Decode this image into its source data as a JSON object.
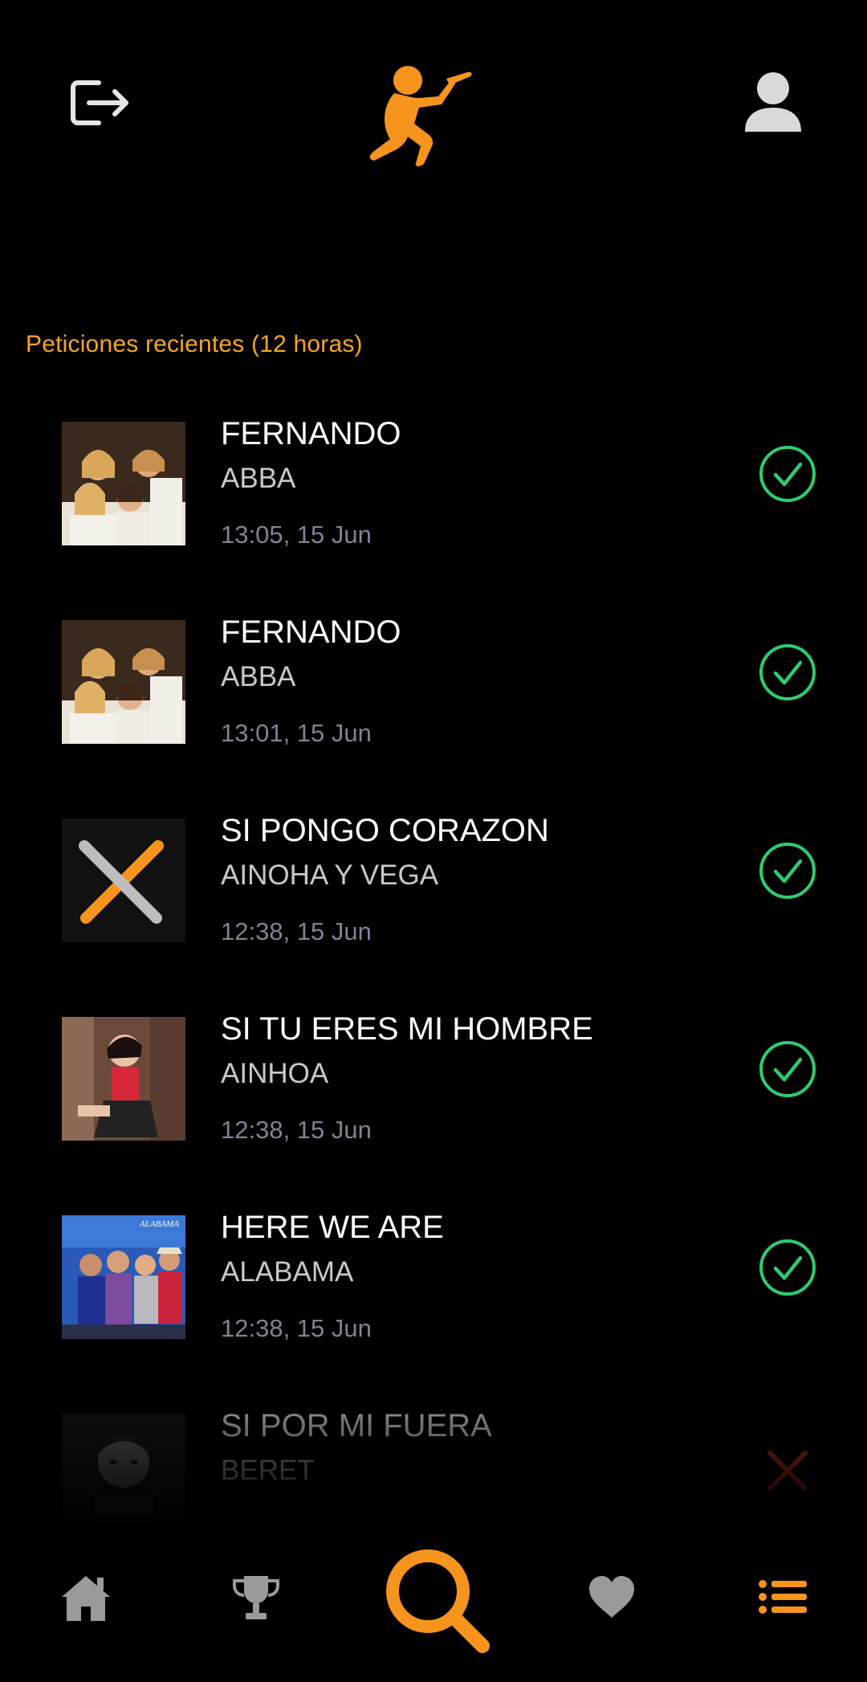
{
  "header": {
    "logout_icon": "logout-icon",
    "logo_icon": "singer-logo-icon",
    "profile_icon": "user-icon",
    "accent_color": "#f7941d"
  },
  "section": {
    "title": "Peticiones recientes (12 horas)"
  },
  "requests": [
    {
      "title": "FERNANDO",
      "artist": "ABBA",
      "time": "13:05, 15 Jun",
      "status": "accepted",
      "thumb": "abba-cover"
    },
    {
      "title": "FERNANDO",
      "artist": "ABBA",
      "time": "13:01, 15 Jun",
      "status": "accepted",
      "thumb": "abba-cover"
    },
    {
      "title": "SI PONGO CORAZON",
      "artist": "AINOHA Y VEGA",
      "time": "12:38, 15 Jun",
      "status": "accepted",
      "thumb": "placeholder-x"
    },
    {
      "title": "SI TU ERES MI HOMBRE",
      "artist": "AINHOA",
      "time": "12:38, 15 Jun",
      "status": "accepted",
      "thumb": "ainhoa-photo"
    },
    {
      "title": "HERE WE ARE",
      "artist": "ALABAMA",
      "time": "12:38, 15 Jun",
      "status": "accepted",
      "thumb": "alabama-cover",
      "thumb_caption": "ALABAMA"
    },
    {
      "title": "SI POR MI FUERA",
      "artist": "BERET",
      "time": "",
      "status": "rejected",
      "thumb": "beret-cover"
    }
  ],
  "status_colors": {
    "accepted": "#2ecc71",
    "rejected": "#e53935"
  },
  "bottom_nav": [
    {
      "icon": "home-icon",
      "active": false
    },
    {
      "icon": "trophy-icon",
      "active": false
    },
    {
      "icon": "search-icon",
      "active": true
    },
    {
      "icon": "heart-icon",
      "active": false
    },
    {
      "icon": "list-icon",
      "active": true
    }
  ]
}
